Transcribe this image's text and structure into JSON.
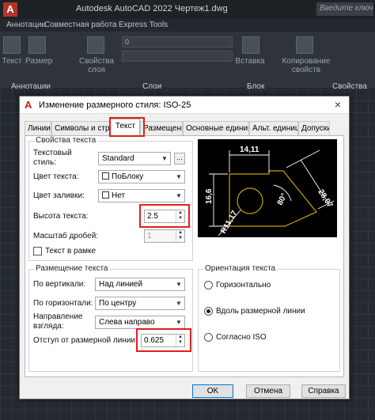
{
  "titlebar": {
    "logo": "A",
    "title": "Autodesk AutoCAD 2022   Чертеж1.dwg",
    "search_placeholder": "Введите ключев"
  },
  "ribbon_tabs": [
    "Аннотации",
    "Совместная работа",
    "Express Tools"
  ],
  "ribbon": {
    "buttons": [
      "Текст",
      "Размер",
      "Свойства слоя",
      "Вставка",
      "Копирование свойств"
    ],
    "panels": [
      "Аннотации",
      "Слои",
      "Блок",
      "Свойства"
    ],
    "layer_value": "0"
  },
  "dialog": {
    "title": "Изменение размерного стиля: ISO-25",
    "close": "×",
    "tabs": [
      "Линии",
      "Символы и стрелки",
      "Текст",
      "Размещение",
      "Основные единицы",
      "Альт. единицы",
      "Допуски"
    ],
    "active_tab": "Текст",
    "text_props": {
      "group_title": "Свойства текста",
      "style_label": "Текстовый стиль:",
      "style_value": "Standard",
      "style_button": "...",
      "color_label": "Цвет текста:",
      "color_value": "ПоБлоку",
      "fill_label": "Цвет заливки:",
      "fill_value": "Нет",
      "height_label": "Высота текста:",
      "height_value": "2.5",
      "fraction_label": "Масштаб дробей:",
      "fraction_value": "1",
      "frame_label": "Текст в рамке",
      "frame_checked": false
    },
    "placement": {
      "group_title": "Размещение текста",
      "vertical_label": "По вертикали:",
      "vertical_value": "Над линией",
      "horizontal_label": "По горизонтали:",
      "horizontal_value": "По центру",
      "direction_label": "Направление взгляда:",
      "direction_value": "Слева направо",
      "offset_label": "Отступ от размерной линии:",
      "offset_value": "0.625"
    },
    "orientation": {
      "group_title": "Ориентация текста",
      "options": [
        "Горизонтально",
        "Вдоль размерной линии",
        "Согласно ISO"
      ],
      "selected": "Вдоль размерной линии"
    },
    "preview": {
      "dim_top": "14,11",
      "dim_left": "16,6",
      "dim_right": "28,07",
      "dim_angle": "80°",
      "dim_radius": "R11,17"
    },
    "buttons": {
      "ok": "OK",
      "cancel": "Отмена",
      "help": "Справка"
    },
    "colors": {
      "highlight": "#e01f1f",
      "preview_bg": "#000000",
      "preview_shape": "#c8a400",
      "preview_dims": "#ffffff"
    }
  }
}
